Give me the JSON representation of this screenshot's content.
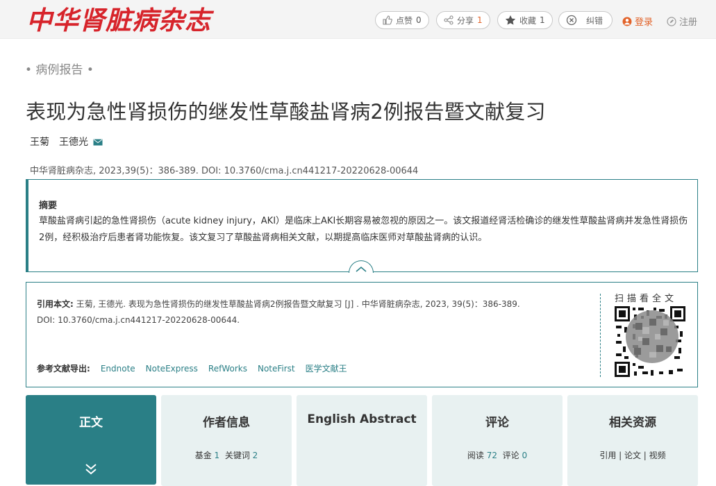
{
  "header": {
    "logo": "中华肾脏病杂志",
    "actions": {
      "like_label": "点赞",
      "like_count": "0",
      "share_label": "分享",
      "share_count": "1",
      "collect_label": "收藏",
      "collect_count": "1",
      "correct_label": "纠错"
    },
    "login": "登录",
    "register": "注册"
  },
  "article": {
    "category": "• 病例报告 •",
    "title": "表现为急性肾损伤的继发性草酸盐肾病2例报告暨文献复习",
    "authors": [
      "王菊",
      "王德光"
    ],
    "citation_line": "中华肾脏病杂志, 2023,39(5)：386-389. DOI: 10.3760/cma.j.cn441217-20220628-00644"
  },
  "abstract": {
    "heading": "摘要",
    "text": "草酸盐肾病引起的急性肾损伤（acute kidney injury，AKI）是临床上AKI长期容易被忽视的原因之一。该文报道经肾活检确诊的继发性草酸盐肾病并发急性肾损伤2例，经积极治疗后患者肾功能恢复。该文复习了草酸盐肾病相关文献，以期提高临床医师对草酸盐肾病的认识。"
  },
  "cite": {
    "label": "引用本文:",
    "text": "王菊, 王德光. 表现为急性肾损伤的继发性草酸盐肾病2例报告暨文献复习 [J] . 中华肾脏病杂志, 2023, 39(5)：386-389.",
    "doi": "DOI: 10.3760/cma.j.cn441217-20220628-00644.",
    "export_label": "参考文献导出:",
    "export_links": [
      "Endnote",
      "NoteExpress",
      "RefWorks",
      "NoteFirst",
      "医学文献王"
    ],
    "qr_label": "扫描看全文"
  },
  "tabs": [
    {
      "label": "正文"
    },
    {
      "label": "作者信息",
      "meta": [
        {
          "k": "基金",
          "v": "1"
        },
        {
          "k": "关键词",
          "v": "2"
        }
      ]
    },
    {
      "label": "English Abstract"
    },
    {
      "label": "评论",
      "meta": [
        {
          "k": "阅读",
          "v": "72"
        },
        {
          "k": "评论",
          "v": "0"
        }
      ]
    },
    {
      "label": "相关资源",
      "meta_text": "引用 | 论文 | 视频"
    }
  ],
  "colors": {
    "brand": "#d7242b",
    "accent": "#2a7f86",
    "login": "#e2632a"
  }
}
